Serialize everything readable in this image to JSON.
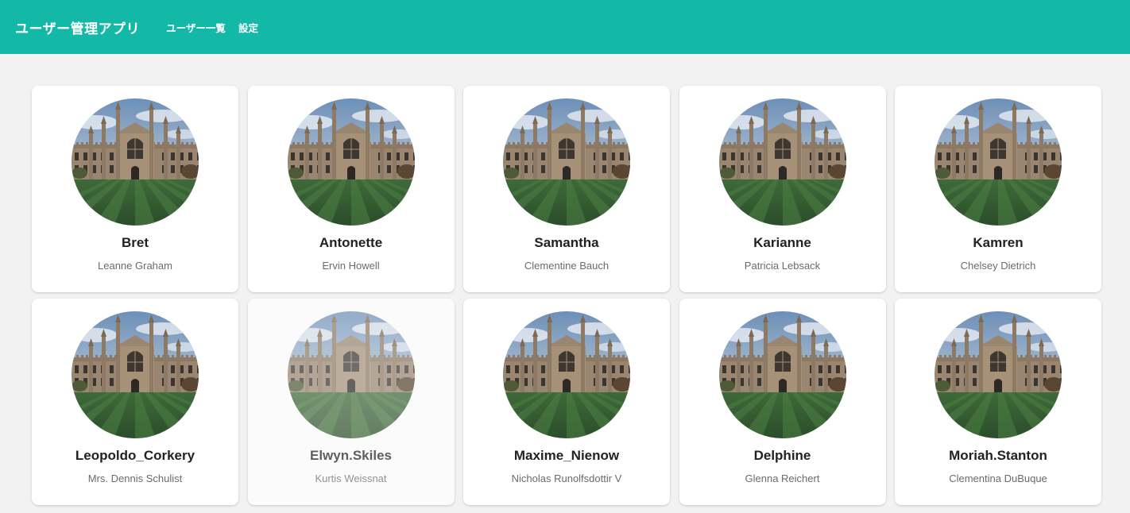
{
  "header": {
    "app_title": "ユーザー管理アプリ",
    "nav": [
      {
        "label": "ユーザー一覧"
      },
      {
        "label": "設定"
      }
    ],
    "accent_color": "#14b8a6"
  },
  "users": [
    {
      "username": "Bret",
      "name": "Leanne Graham",
      "avatar_icon": "college-building-photo"
    },
    {
      "username": "Antonette",
      "name": "Ervin Howell",
      "avatar_icon": "college-building-photo"
    },
    {
      "username": "Samantha",
      "name": "Clementine Bauch",
      "avatar_icon": "college-building-photo"
    },
    {
      "username": "Karianne",
      "name": "Patricia Lebsack",
      "avatar_icon": "college-building-photo"
    },
    {
      "username": "Kamren",
      "name": "Chelsey Dietrich",
      "avatar_icon": "college-building-photo"
    },
    {
      "username": "Leopoldo_Corkery",
      "name": "Mrs. Dennis Schulist",
      "avatar_icon": "college-building-photo"
    },
    {
      "username": "Elwyn.Skiles",
      "name": "Kurtis Weissnat",
      "avatar_icon": "college-building-photo",
      "hovered": true
    },
    {
      "username": "Maxime_Nienow",
      "name": "Nicholas Runolfsdottir V",
      "avatar_icon": "college-building-photo"
    },
    {
      "username": "Delphine",
      "name": "Glenna Reichert",
      "avatar_icon": "college-building-photo"
    },
    {
      "username": "Moriah.Stanton",
      "name": "Clementina DuBuque",
      "avatar_icon": "college-building-photo"
    }
  ]
}
